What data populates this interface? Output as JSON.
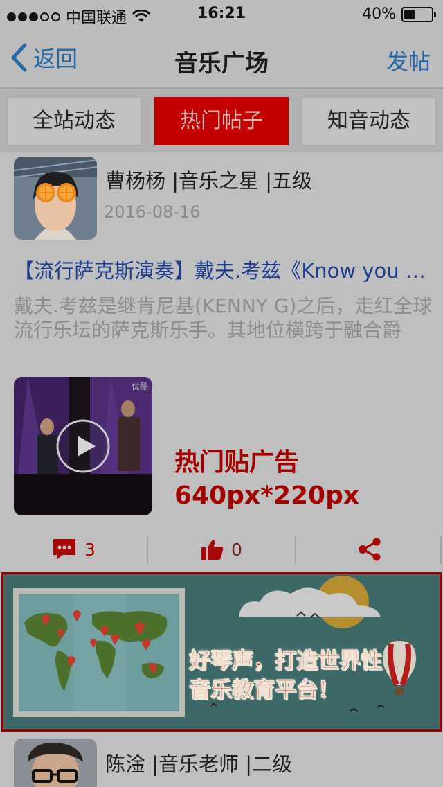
{
  "status_bar": {
    "carrier": "中国联通",
    "time": "16:21",
    "battery": "40%",
    "battery_level": 0.4
  },
  "nav": {
    "back_label": "返回",
    "title": "音乐广场",
    "action_label": "发帖"
  },
  "tabs": [
    {
      "label": "全站动态",
      "active": false
    },
    {
      "label": "热门帖子",
      "active": true
    },
    {
      "label": "知音动态",
      "active": false
    }
  ],
  "post": {
    "author": "曹杨杨 |音乐之星 |五级",
    "date": "2016-08-16",
    "title": "【流行萨克斯演奏】戴夫.考兹《Know you by heart》",
    "excerpt": "戴夫.考兹是继肯尼基(KENNY G)之后，走红全球流行乐坛的萨克斯乐手。其地位横跨于融合爵",
    "video_watermark": "优酷",
    "ad_caption_line1": "热门贴广告",
    "ad_caption_line2": "640px*220px",
    "comments": "3",
    "likes": "0"
  },
  "banner": {
    "line1": "好琴声，打造世界性",
    "line2": "音乐教育平台！"
  },
  "post2": {
    "author": "陈淦 |音乐老师 |二级"
  },
  "colors": {
    "accent_red": "#c40000",
    "link_blue": "#2469a8",
    "title_blue": "#1f3d8f"
  }
}
